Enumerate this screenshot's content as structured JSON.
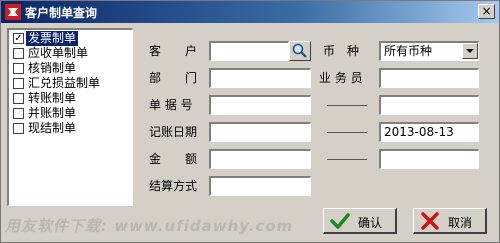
{
  "window": {
    "title": "客户制单查询",
    "close_label": "×"
  },
  "type_list": [
    {
      "label": "发票制单",
      "checked": true,
      "selected": true
    },
    {
      "label": "应收单制单",
      "checked": false,
      "selected": false
    },
    {
      "label": "核销制单",
      "checked": false,
      "selected": false
    },
    {
      "label": "汇兑损益制单",
      "checked": false,
      "selected": false
    },
    {
      "label": "转账制单",
      "checked": false,
      "selected": false
    },
    {
      "label": "并账制单",
      "checked": false,
      "selected": false
    },
    {
      "label": "现结制单",
      "checked": false,
      "selected": false
    }
  ],
  "check_mark": "✓",
  "form": {
    "customer_label": "客　　户",
    "customer_value": "",
    "department_label": "部　　门",
    "department_value": "",
    "doc_no_label": "单 据 号",
    "doc_no_from": "",
    "doc_no_to": "",
    "date_label": "记账日期",
    "date_from": "",
    "date_to": "2013-08-13",
    "amount_label": "金　　额",
    "amount_from": "",
    "amount_to": "",
    "settle_label": "结算方式",
    "settle_value": "",
    "currency_label": "币　种",
    "currency_value": "所有币种",
    "clerk_label": "业 务 员",
    "clerk_value": ""
  },
  "buttons": {
    "ok": "确认",
    "cancel": "取消"
  },
  "watermark": "用友软件下载: www.ufidawhy.com"
}
